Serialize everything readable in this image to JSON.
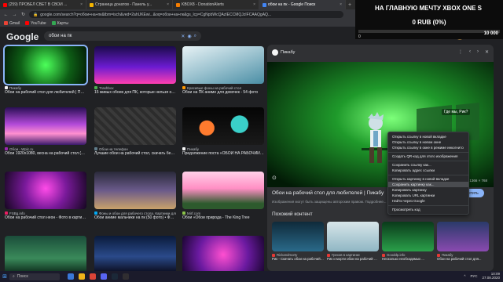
{
  "browser": {
    "tabs": [
      {
        "label": "(259) ПРОБЕЛ СВЕТ В СВОЙ ...",
        "color": "#ff0000",
        "active": false
      },
      {
        "label": "Страница донатов - Панель у...",
        "color": "#f4b400",
        "active": false
      },
      {
        "label": "KBOX8 - DonationAlerts",
        "color": "#f57d00",
        "active": false
      },
      {
        "label": "обои на пк - Google Поиск",
        "color": "#4285f4",
        "active": true
      }
    ],
    "close_glyph": "×",
    "new_tab_glyph": "+",
    "url": "google.com/search?q=обои+на+пк&tbm=isch&ved=2ahUKEwi...&oq=обои+на+пк&gs_lcp=CgNpbWcQAzIECCMQJzIFCAAQgAQ...",
    "bookmarks": [
      {
        "label": "Gmail",
        "color": "#ea4335"
      },
      {
        "label": "YouTube",
        "color": "#ff0000"
      },
      {
        "label": "Карты",
        "color": "#34a853"
      }
    ]
  },
  "google": {
    "logo": "Google",
    "query": "обои на пк",
    "apps_icon": "grid-icon"
  },
  "overlay": {
    "title": "НА ГЛАВНУЮ МЕЧТУ XBOX ONE S",
    "sum": "0 RUB (0%)",
    "progress": 0,
    "min": "0",
    "max": "10 000"
  },
  "results": [
    {
      "source": "Пикабу",
      "caption": "Обои на рабочий стол для любителей | Пикабу",
      "fav": "#f5f5f5"
    },
    {
      "source": "Trashbox",
      "caption": "15 живых обоев для ПК, которые нельзя от...",
      "fav": "#4caf50"
    },
    {
      "source": "Красивые фоны на рабочий стол",
      "caption": "Обои на ПК аниме для девочек - 54 фото",
      "fav": "#ff9800"
    },
    {
      "source": "Обои - Wpic.ru",
      "caption": "Обои 1920x1080, весна на рабочий стол (362 ...",
      "fav": "#9c27b0"
    },
    {
      "source": "Обои на телефон",
      "caption": "Лучшие обои на рабочий стол, скачать бес...",
      "fav": "#607d8b"
    },
    {
      "source": "Пикабу",
      "caption": "Предолжение поста «ОБОИ НА РАБОЧИЙ ...",
      "fav": "#f5f5f5"
    },
    {
      "source": "FSBg.info",
      "caption": "Обои на рабочий стол неон - Фото в картинк...",
      "fav": "#e91e63"
    },
    {
      "source": "Фоны и обои для рабочего стола. Картинки для ...",
      "caption": "Обои аниме мальчики на пк (50 фото) • Фон...",
      "fav": "#03a9f4"
    },
    {
      "source": "Mirf.com",
      "caption": "Обои «Обои природа - The King Tree",
      "fav": "#8bc34a"
    },
    {
      "source": "",
      "caption": "",
      "fav": "#555"
    },
    {
      "source": "",
      "caption": "",
      "fav": "#555"
    },
    {
      "source": "",
      "caption": "",
      "fav": "#555"
    }
  ],
  "preview": {
    "source": "Пикабу",
    "title": "Обои на рабочий стол для любителей | Пикабу",
    "visit": "Посетить",
    "note": "Изображения могут быть защищены авторским правом. Подробнее...",
    "dimensions": "1366 × 768",
    "related_title": "Похожий контент",
    "ctrl_icons": [
      "more-icon",
      "prev-icon",
      "next-icon",
      "close-icon"
    ],
    "speech": "Где мы, Рик?",
    "related": [
      {
        "source": "Rickandmorty",
        "caption": "Рик - Скачать обои на рабочий ..."
      },
      {
        "source": "Грехов в картинке",
        "caption": "Рик и морти обои на рабочий стол..."
      },
      {
        "source": "Gooddp.info",
        "caption": "Несколько необходимых ..."
      },
      {
        "source": "Пикабу",
        "caption": "Обои на рабочий стол для..."
      }
    ]
  },
  "context_menu": {
    "items": [
      {
        "label": "Открыть ссылку в новой вкладке",
        "sep": false,
        "hl": false
      },
      {
        "label": "Открыть ссылку в новом окне",
        "sep": false,
        "hl": false
      },
      {
        "label": "Открыть ссылку в окне в режиме инкогнито",
        "sep": true,
        "hl": false
      },
      {
        "label": "Создать QR-код для этого изображения",
        "sep": true,
        "hl": false
      },
      {
        "label": "Сохранить ссылку как...",
        "sep": false,
        "hl": false
      },
      {
        "label": "Копировать адрес ссылки",
        "sep": true,
        "hl": false
      },
      {
        "label": "Открыть картинку в новой вкладке",
        "sep": false,
        "hl": false
      },
      {
        "label": "Сохранить картинку как...",
        "sep": false,
        "hl": true
      },
      {
        "label": "Копировать картинку",
        "sep": false,
        "hl": false
      },
      {
        "label": "Копировать URL картинки",
        "sep": false,
        "hl": false
      },
      {
        "label": "Найти через Google",
        "sep": true,
        "hl": false
      },
      {
        "label": "Просмотреть код",
        "sep": false,
        "hl": false
      }
    ]
  },
  "taskbar": {
    "search_placeholder": "Поиск",
    "lang": "РУС",
    "time": "10:09",
    "date": "27.08.2020"
  }
}
